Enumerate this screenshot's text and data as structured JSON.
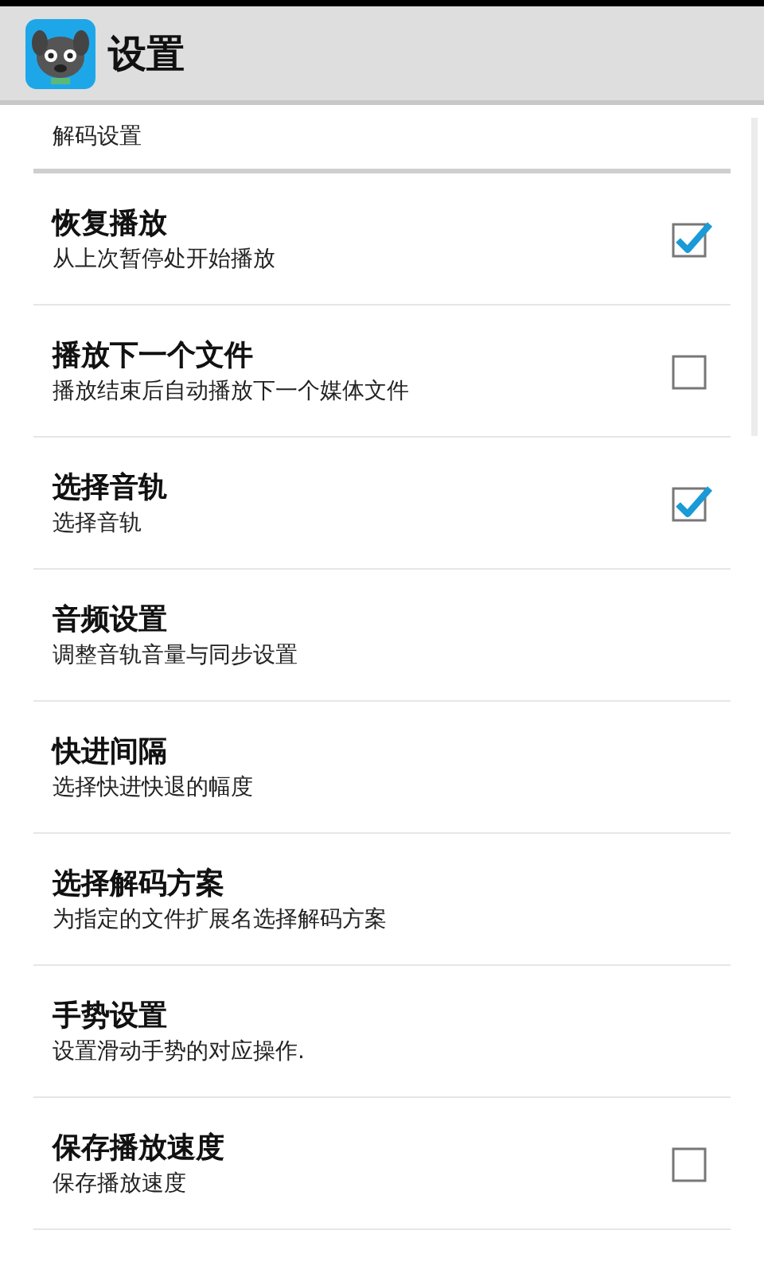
{
  "action_bar": {
    "title": "设置"
  },
  "category": "解码设置",
  "items": [
    {
      "kind": "checkbox",
      "title": "恢复播放",
      "summary": "从上次暂停处开始播放",
      "checked": true
    },
    {
      "kind": "checkbox",
      "title": "播放下一个文件",
      "summary": "播放结束后自动播放下一个媒体文件",
      "checked": false
    },
    {
      "kind": "checkbox",
      "title": "选择音轨",
      "summary": "选择音轨",
      "checked": true
    },
    {
      "kind": "plain",
      "title": "音频设置",
      "summary": "调整音轨音量与同步设置"
    },
    {
      "kind": "plain",
      "title": "快进间隔",
      "summary": "选择快进快退的幅度"
    },
    {
      "kind": "plain",
      "title": "选择解码方案",
      "summary": "为指定的文件扩展名选择解码方案"
    },
    {
      "kind": "plain",
      "title": "手势设置",
      "summary": "设置滑动手势的对应操作."
    },
    {
      "kind": "checkbox",
      "title": "保存播放速度",
      "summary": "保存播放速度",
      "checked": false
    }
  ]
}
